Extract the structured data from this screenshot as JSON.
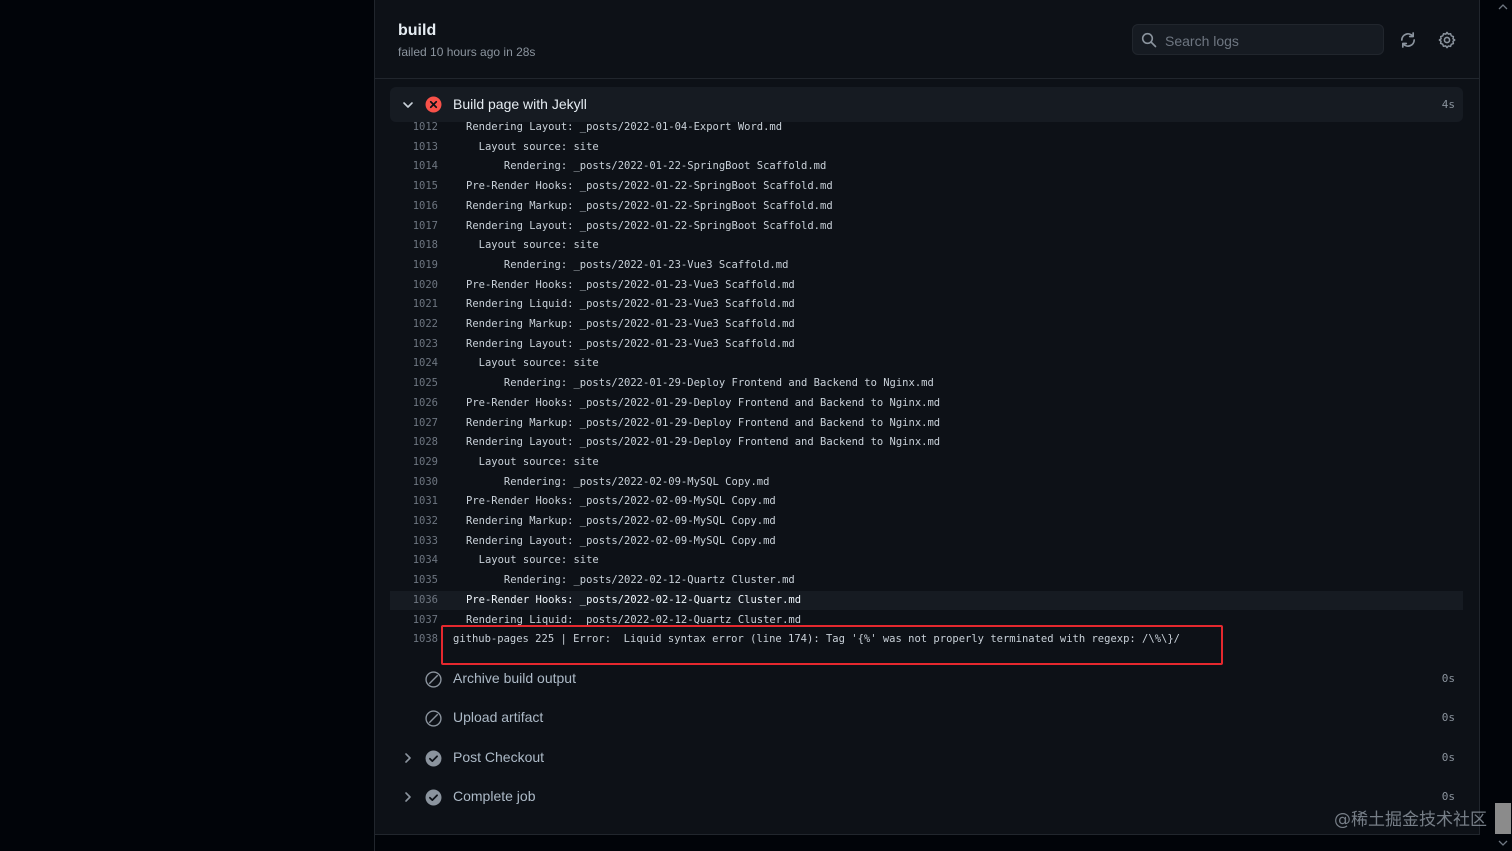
{
  "job": {
    "title": "build",
    "status": "failed 10 hours ago in 28s"
  },
  "search": {
    "placeholder": "Search logs"
  },
  "header_buttons": {
    "refresh_icon": "refresh-icon",
    "settings_icon": "gear-icon"
  },
  "current_step": {
    "label": "Build page with Jekyll",
    "duration": "4s",
    "status": "failed",
    "logs": [
      {
        "num": "1012",
        "text": "Rendering Layout: _posts/2022-01-04-Export Word.md"
      },
      {
        "num": "1013",
        "text": "  Layout source: site"
      },
      {
        "num": "1014",
        "text": "      Rendering: _posts/2022-01-22-SpringBoot Scaffold.md"
      },
      {
        "num": "1015",
        "text": "Pre-Render Hooks: _posts/2022-01-22-SpringBoot Scaffold.md"
      },
      {
        "num": "1016",
        "text": "Rendering Markup: _posts/2022-01-22-SpringBoot Scaffold.md"
      },
      {
        "num": "1017",
        "text": "Rendering Layout: _posts/2022-01-22-SpringBoot Scaffold.md"
      },
      {
        "num": "1018",
        "text": "  Layout source: site"
      },
      {
        "num": "1019",
        "text": "      Rendering: _posts/2022-01-23-Vue3 Scaffold.md"
      },
      {
        "num": "1020",
        "text": "Pre-Render Hooks: _posts/2022-01-23-Vue3 Scaffold.md"
      },
      {
        "num": "1021",
        "text": "Rendering Liquid: _posts/2022-01-23-Vue3 Scaffold.md"
      },
      {
        "num": "1022",
        "text": "Rendering Markup: _posts/2022-01-23-Vue3 Scaffold.md"
      },
      {
        "num": "1023",
        "text": "Rendering Layout: _posts/2022-01-23-Vue3 Scaffold.md"
      },
      {
        "num": "1024",
        "text": "  Layout source: site"
      },
      {
        "num": "1025",
        "text": "      Rendering: _posts/2022-01-29-Deploy Frontend and Backend to Nginx.md"
      },
      {
        "num": "1026",
        "text": "Pre-Render Hooks: _posts/2022-01-29-Deploy Frontend and Backend to Nginx.md"
      },
      {
        "num": "1027",
        "text": "Rendering Markup: _posts/2022-01-29-Deploy Frontend and Backend to Nginx.md"
      },
      {
        "num": "1028",
        "text": "Rendering Layout: _posts/2022-01-29-Deploy Frontend and Backend to Nginx.md"
      },
      {
        "num": "1029",
        "text": "  Layout source: site"
      },
      {
        "num": "1030",
        "text": "      Rendering: _posts/2022-02-09-MySQL Copy.md"
      },
      {
        "num": "1031",
        "text": "Pre-Render Hooks: _posts/2022-02-09-MySQL Copy.md"
      },
      {
        "num": "1032",
        "text": "Rendering Markup: _posts/2022-02-09-MySQL Copy.md"
      },
      {
        "num": "1033",
        "text": "Rendering Layout: _posts/2022-02-09-MySQL Copy.md"
      },
      {
        "num": "1034",
        "text": "  Layout source: site"
      },
      {
        "num": "1035",
        "text": "      Rendering: _posts/2022-02-12-Quartz Cluster.md"
      },
      {
        "num": "1036",
        "text": "Pre-Render Hooks: _posts/2022-02-12-Quartz Cluster.md"
      },
      {
        "num": "1037",
        "text": "Rendering Liquid: _posts/2022-02-12-Quartz Cluster.md"
      },
      {
        "num": "1038",
        "text": "github-pages 225 | Error:  Liquid syntax error (line 174): Tag '{%' was not properly terminated with regexp: /\\%\\}/"
      }
    ]
  },
  "steps": [
    {
      "label": "Archive build output",
      "duration": "0s",
      "status": "skipped",
      "expandable": false
    },
    {
      "label": "Upload artifact",
      "duration": "0s",
      "status": "skipped",
      "expandable": false
    },
    {
      "label": "Post Checkout",
      "duration": "0s",
      "status": "success",
      "expandable": true
    },
    {
      "label": "Complete job",
      "duration": "0s",
      "status": "success",
      "expandable": true
    }
  ],
  "watermark": "@稀土掘金技术社区",
  "colors": {
    "background": "#0d1117",
    "error_red": "#f85149",
    "highlight_box": "#e5282e",
    "muted": "#8b949e"
  }
}
